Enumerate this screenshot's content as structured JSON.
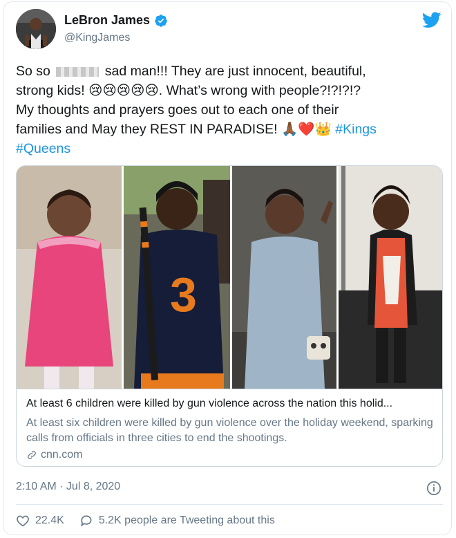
{
  "author": {
    "name": "LeBron James",
    "handle": "@KingJames"
  },
  "tweet": {
    "line1_a": "So so",
    "line1_b": "sad man!!! They are just innocent, beautiful,",
    "line2_a": "strong kids!",
    "line2_emoji": "😢😢😢😢😢",
    "line2_b": ". What’s wrong with people?!?!?!?",
    "line3": "My thoughts and prayers goes out to each one of their",
    "line4_a": "families and May they REST IN PARADISE!",
    "line4_emoji": "🙏🏾❤️👑",
    "hashtag1": "#Kings",
    "hashtag2": "#Queens"
  },
  "card": {
    "title": "At least 6 children were killed by gun violence across the nation this holid...",
    "description": "At least six children were killed by gun violence over the holiday weekend, sparking calls from officials in three cities to end the shootings.",
    "domain": "cnn.com"
  },
  "meta": {
    "timestamp": "2:10 AM · Jul 8, 2020",
    "likes": "22.4K",
    "talking": "5.2K people are Tweeting about this"
  },
  "colors": {
    "link": "#1b95e0",
    "secondary": "#657786",
    "border": "#ccd6dd",
    "twitter_blue": "#1da1f2"
  },
  "icons": [
    "verified-badge-icon",
    "twitter-bird-icon",
    "link-icon",
    "info-icon",
    "heart-icon",
    "comment-bubble-icon"
  ]
}
